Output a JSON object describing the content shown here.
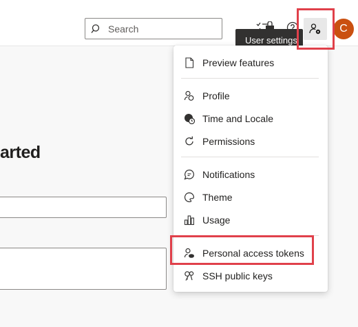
{
  "header": {
    "search": {
      "placeholder": "Search"
    },
    "tooltip": "User settings",
    "avatar_initial": "C"
  },
  "main": {
    "heading": "arted"
  },
  "menu": {
    "items": [
      {
        "label": "Preview features",
        "icon": "page-icon"
      },
      {
        "label": "Profile",
        "icon": "profile-icon"
      },
      {
        "label": "Time and Locale",
        "icon": "globe-clock-icon"
      },
      {
        "label": "Permissions",
        "icon": "refresh-icon"
      },
      {
        "label": "Notifications",
        "icon": "chat-icon"
      },
      {
        "label": "Theme",
        "icon": "palette-icon"
      },
      {
        "label": "Usage",
        "icon": "bar-chart-icon"
      },
      {
        "label": "Personal access tokens",
        "icon": "key-person-icon"
      },
      {
        "label": "SSH public keys",
        "icon": "keys-icon"
      }
    ]
  },
  "colors": {
    "avatar": "#ca5010",
    "highlight": "#e0404a",
    "tooltip_bg": "#323130"
  }
}
